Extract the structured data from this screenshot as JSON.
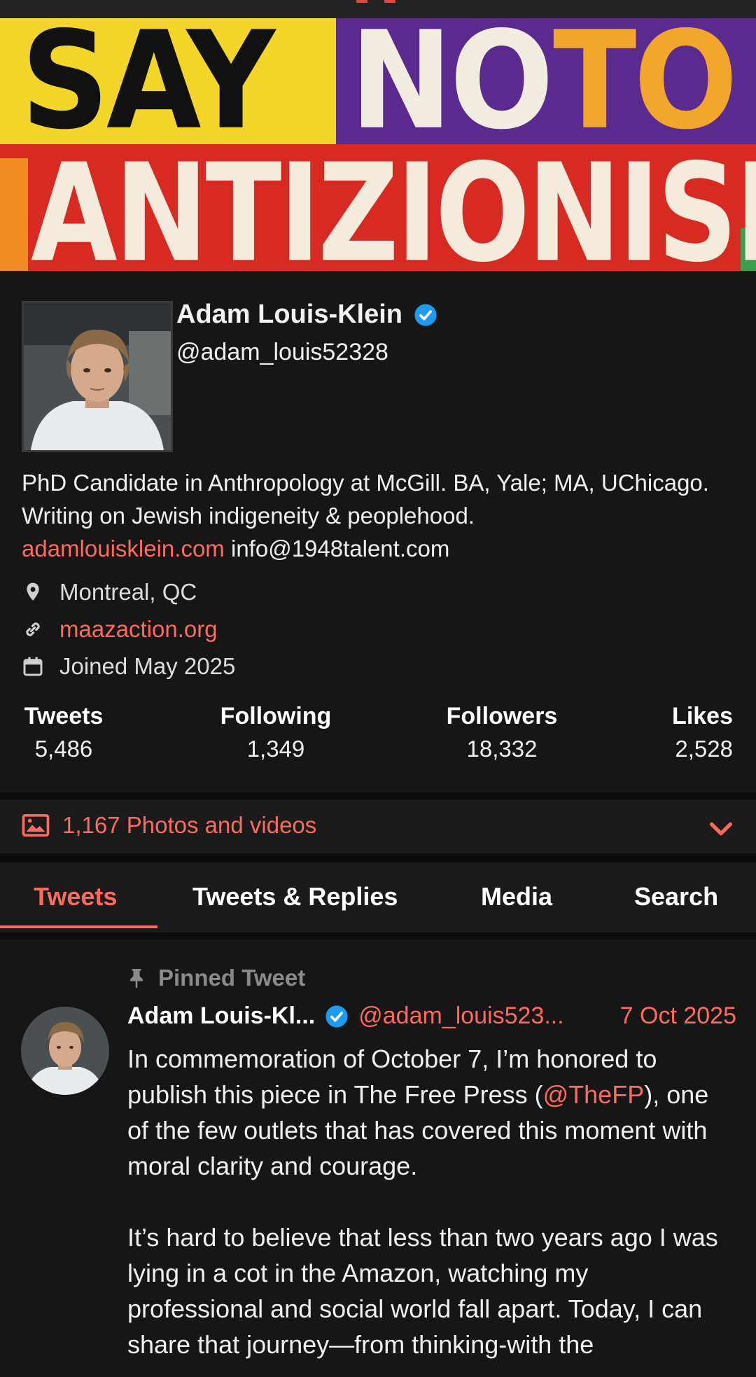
{
  "banner": {
    "line1_word1": "SAY",
    "line1_word2": "NO",
    "line1_word3": "TO",
    "line2": "ANTIZIONISM"
  },
  "profile": {
    "name": "Adam Louis-Klein",
    "handle": "@adam_louis52328",
    "bio": "PhD Candidate in Anthropology at McGill. BA, Yale; MA, UChicago. Writing on Jewish indigeneity & peoplehood.",
    "bio_link": "adamlouisklein.com",
    "bio_email": "info@1948talent.com",
    "location": "Montreal, QC",
    "website": "maazaction.org",
    "joined": "Joined May 2025"
  },
  "stats": [
    {
      "label": "Tweets",
      "value": "5,486"
    },
    {
      "label": "Following",
      "value": "1,349"
    },
    {
      "label": "Followers",
      "value": "18,332"
    },
    {
      "label": "Likes",
      "value": "2,528"
    }
  ],
  "photos_label": "1,167 Photos and videos",
  "tabs": [
    {
      "label": "Tweets",
      "active": true
    },
    {
      "label": "Tweets & Replies",
      "active": false
    },
    {
      "label": "Media",
      "active": false
    },
    {
      "label": "Search",
      "active": false
    }
  ],
  "tweet": {
    "pinned_label": "Pinned Tweet",
    "author": "Adam Louis-Kl...",
    "handle": "@adam_louis523...",
    "date": "7 Oct 2025",
    "text_part1": "In commemoration of October 7, I’m honored to publish this piece in The Free Press (",
    "mention": "@TheFP",
    "text_part2": "), one of the few outlets that has covered this moment with moral clarity and courage.\n\nIt’s hard to believe that less than two years ago I was lying in a cot in the Amazon, watching my professional and social world fall apart. Today, I can share that journey—from thinking-with the"
  },
  "colors": {
    "accent": "#ff6a5e",
    "background": "#161616",
    "verified": "#1d9bf0"
  },
  "icons": [
    "location-pin-icon",
    "link-icon",
    "calendar-icon",
    "image-icon",
    "chevron-down-icon",
    "pin-icon",
    "verified-badge-icon"
  ]
}
